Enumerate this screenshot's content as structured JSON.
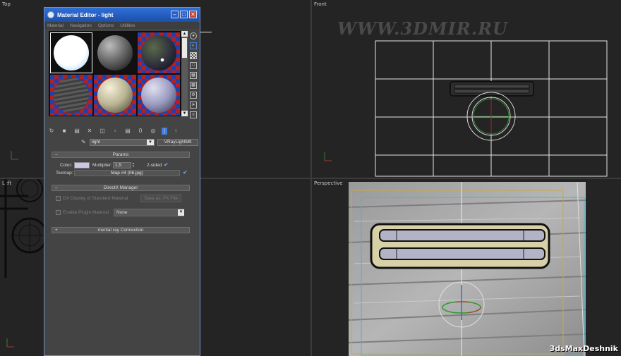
{
  "viewports": {
    "top": "Top",
    "front": "Front",
    "left": "Left",
    "perspective": "Perspective"
  },
  "watermark_top": "WWW.3DMIR.RU",
  "watermark_bottom": "3dsMaxDeshnik",
  "material_editor": {
    "title": "Material Editor - light",
    "menu": [
      "Material",
      "Navigation",
      "Options",
      "Utilities"
    ],
    "material_name": "light",
    "material_type": "VRayLightMtl",
    "params": {
      "rollout_title": "Params",
      "color_label": "Color:",
      "multiplier_label": "Multiplier:",
      "multiplier_value": "1,5",
      "two_sided_label": "2-sided",
      "texmap_label": "Texmap:",
      "texmap_value": "Map #4 (06.jpg)"
    },
    "directx": {
      "rollout_title": "DirectX Manager",
      "dx_display_label": "DX Display of Standard Material",
      "save_fx_label": "Save as .FX File",
      "plugin_label": "Enable Plugin Material",
      "plugin_value": "None"
    },
    "mentalray": {
      "rollout_title": "mental ray Connection"
    }
  },
  "colors": {
    "title_bar": "#1c4fa8",
    "panel": "#444444",
    "grid_line": "#ffffff",
    "accent_blue": "#3f7fe0"
  }
}
